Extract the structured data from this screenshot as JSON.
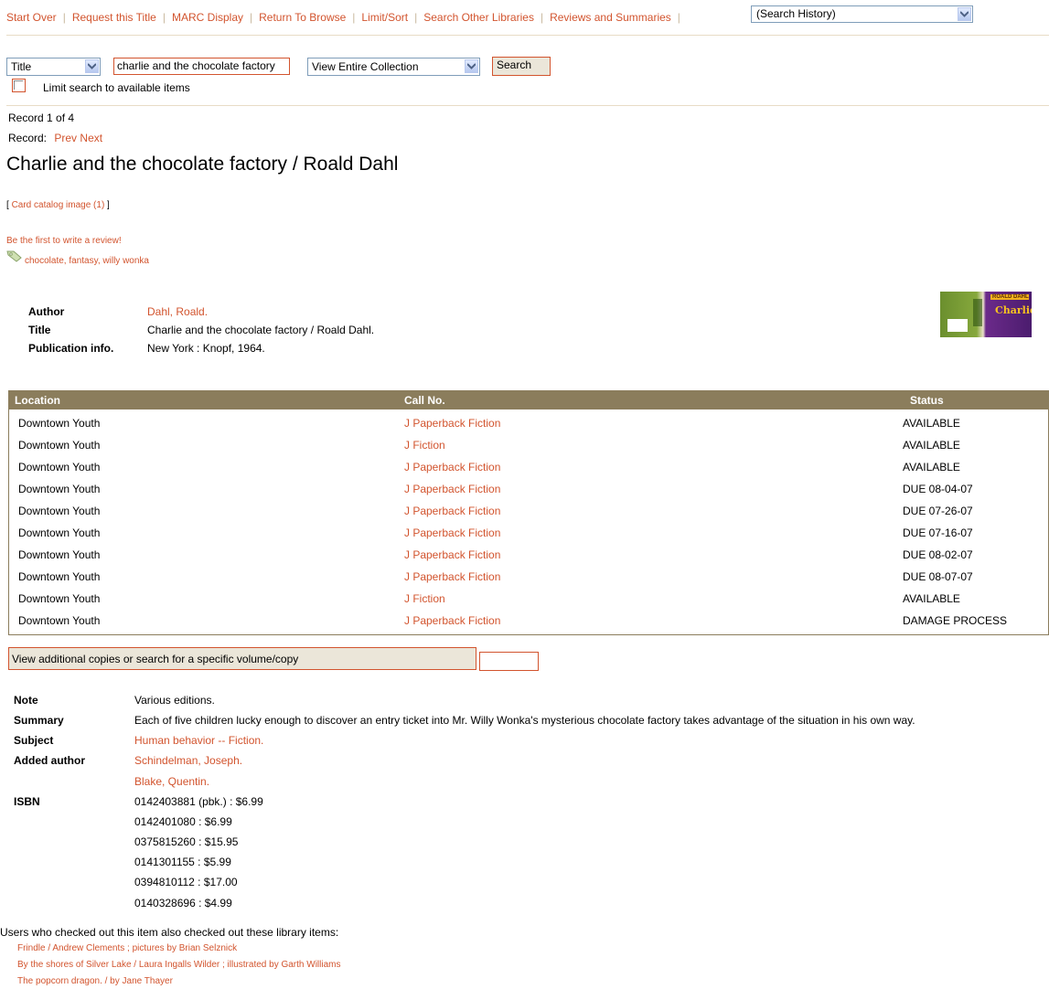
{
  "topnav": {
    "links": [
      "Start Over",
      "Request this Title",
      "MARC Display",
      "Return To Browse",
      "Limit/Sort",
      "Search Other Libraries",
      "Reviews and Summaries"
    ],
    "history_select": "(Search History)"
  },
  "search": {
    "field_select": "Title",
    "query": "charlie and the chocolate factory",
    "scope_select": "View Entire Collection",
    "button": "Search",
    "limit_label": "Limit search to available items"
  },
  "record": {
    "position": "Record 1 of 4",
    "nav_label": "Record:",
    "prev": "Prev",
    "next": "Next",
    "heading": "Charlie and the chocolate factory / Roald Dahl",
    "card_open": "[ ",
    "card_link": "Card catalog image (1)",
    "card_close": " ]",
    "review_link": "Be the first to write a review!",
    "tags": "chocolate, fantasy, willy wonka"
  },
  "biblio": {
    "author_label": "Author",
    "author": "Dahl, Roald.",
    "title_label": "Title",
    "title": "Charlie and the chocolate factory / Roald Dahl.",
    "pub_label": "Publication info.",
    "pub": "New York : Knopf, 1964.",
    "cover": {
      "top_text": "ROALD DAHL",
      "title_text": "Charlie"
    }
  },
  "holdings": {
    "headers": [
      "Location",
      "Call No.",
      "Status"
    ],
    "rows": [
      [
        "Downtown Youth",
        "J Paperback Fiction",
        "AVAILABLE"
      ],
      [
        "Downtown Youth",
        "J Fiction",
        "AVAILABLE"
      ],
      [
        "Downtown Youth",
        "J Paperback Fiction",
        "AVAILABLE"
      ],
      [
        "Downtown Youth",
        "J Paperback Fiction",
        "DUE 08-04-07"
      ],
      [
        "Downtown Youth",
        "J Paperback Fiction",
        "DUE 07-26-07"
      ],
      [
        "Downtown Youth",
        "J Paperback Fiction",
        "DUE 07-16-07"
      ],
      [
        "Downtown Youth",
        "J Paperback Fiction",
        "DUE 08-02-07"
      ],
      [
        "Downtown Youth",
        "J Paperback Fiction",
        "DUE 08-07-07"
      ],
      [
        "Downtown Youth",
        "J Fiction",
        "AVAILABLE"
      ],
      [
        "Downtown Youth",
        "J Paperback Fiction",
        "DAMAGE PROCESS"
      ]
    ],
    "view_copies": "View additional copies or search for a specific volume/copy"
  },
  "details": {
    "note_label": "Note",
    "note": "Various editions.",
    "summary_label": "Summary",
    "summary": "Each of five children lucky enough to discover an entry ticket into Mr. Willy Wonka's mysterious chocolate factory takes advantage of the situation in his own way.",
    "subject_label": "Subject",
    "subject": "Human behavior -- Fiction.",
    "added_label": "Added author",
    "added": [
      "Schindelman, Joseph.",
      "Blake, Quentin."
    ],
    "isbn_label": "ISBN",
    "isbn": [
      "0142403881 (pbk.) : $6.99",
      "0142401080 : $6.99",
      "0375815260 : $15.95",
      "0141301155 : $5.99",
      "0394810112 : $17.00",
      "0140328696 : $4.99"
    ]
  },
  "related": {
    "heading": "Users who checked out this item also checked out these library items:",
    "items": [
      "Frindle / Andrew Clements ; pictures by Brian Selznick",
      "By the shores of Silver Lake / Laura Ingalls Wilder ; illustrated by Garth Williams",
      "The popcorn dragon. / by Jane Thayer"
    ]
  },
  "colors": {
    "link": "#d2542e",
    "table_header": "#8b7d5c",
    "button_bg": "#ebe6d9"
  }
}
